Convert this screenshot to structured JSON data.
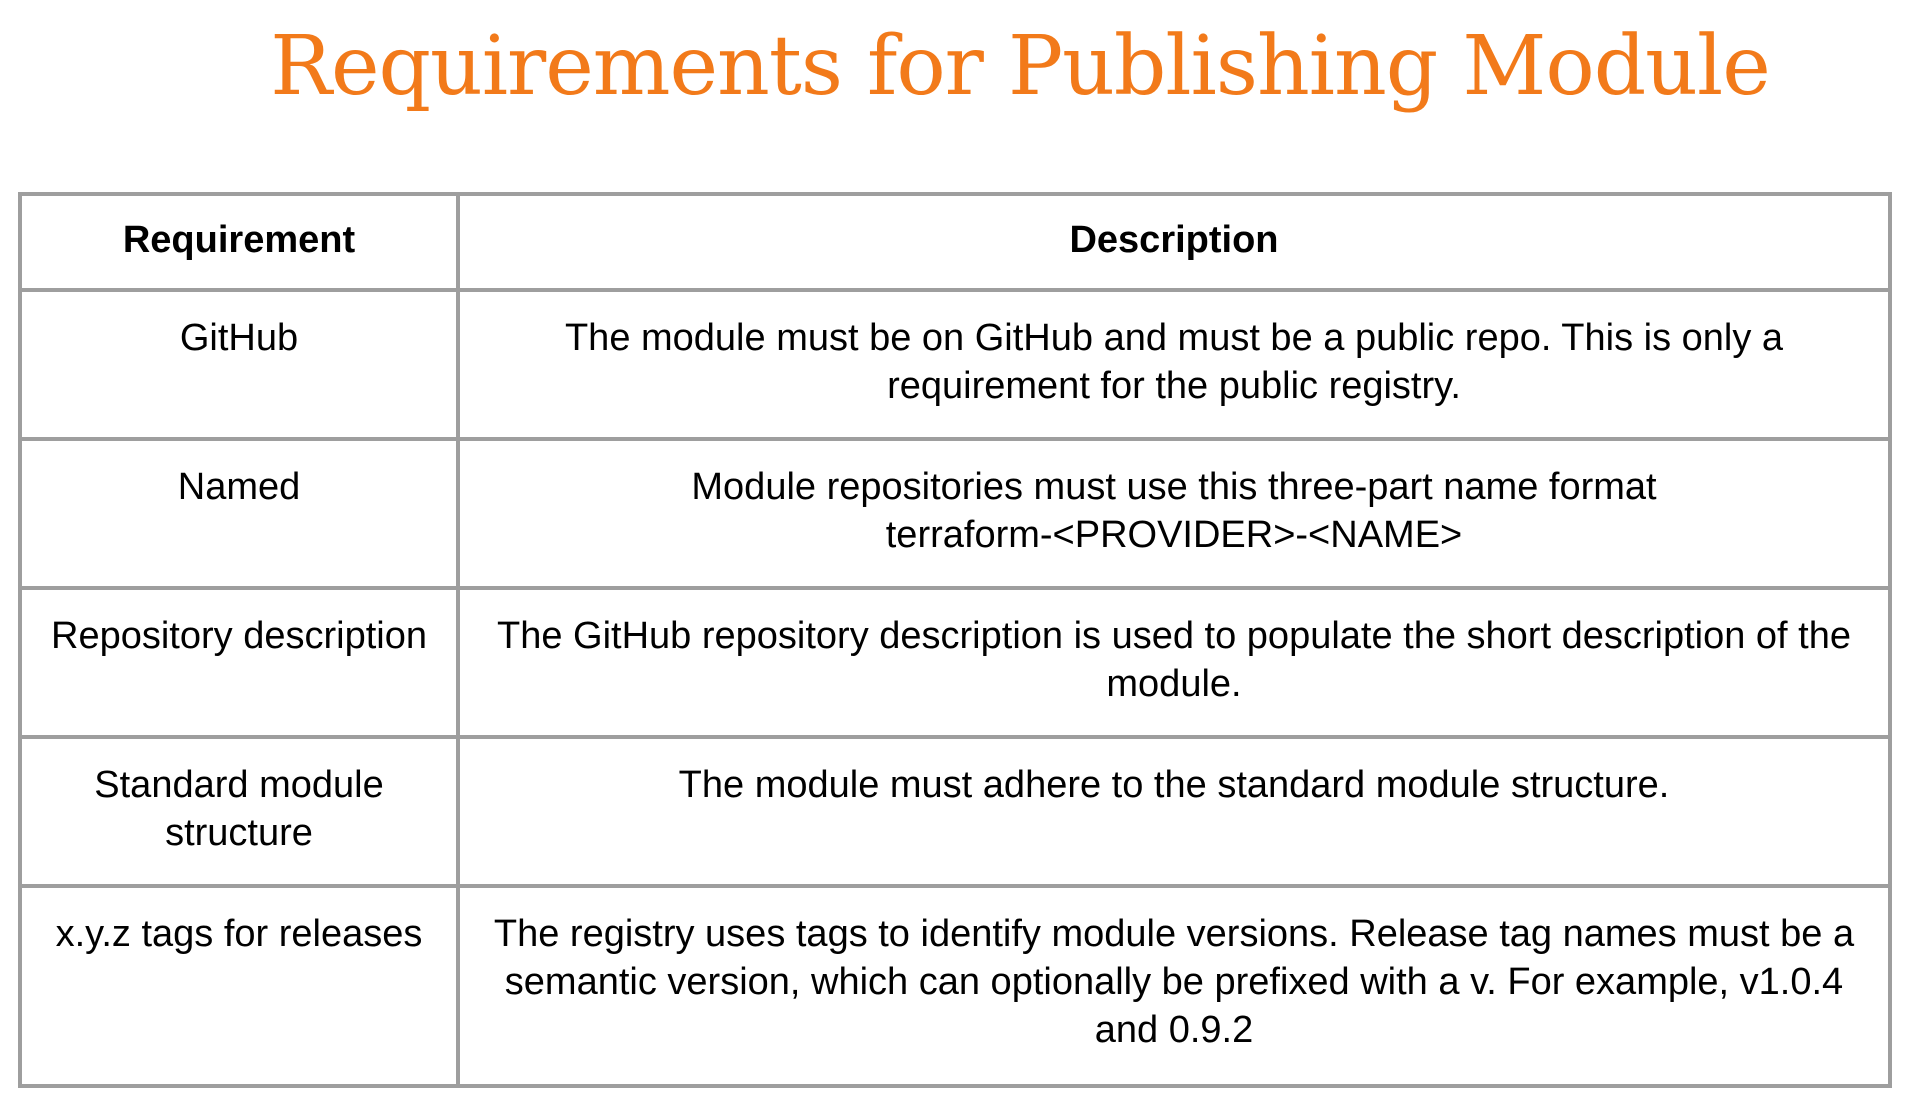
{
  "slide": {
    "title": "Requirements for Publishing Module",
    "title_color": "#F27A1A"
  },
  "table": {
    "headers": [
      "Requirement",
      "Description"
    ],
    "rows": [
      {
        "requirement": "GitHub",
        "description": "The module must be on GitHub and must be a public repo. This is only a requirement for the public registry."
      },
      {
        "requirement": "Named",
        "description_line1": "Module repositories must use this three-part name format",
        "description_line2": "terraform-<PROVIDER>-<NAME>"
      },
      {
        "requirement": "Repository description",
        "description": "The GitHub repository description is used to populate the short description of the module."
      },
      {
        "requirement": "Standard module structure",
        "description": "The module must adhere to the standard module structure."
      },
      {
        "requirement": "x.y.z tags for releases",
        "description": "The registry uses tags to identify module versions. Release tag names must be a semantic version, which can optionally be prefixed with a v. For example, v1.0.4 and 0.9.2"
      }
    ],
    "border_color": "#9E9E9E"
  }
}
